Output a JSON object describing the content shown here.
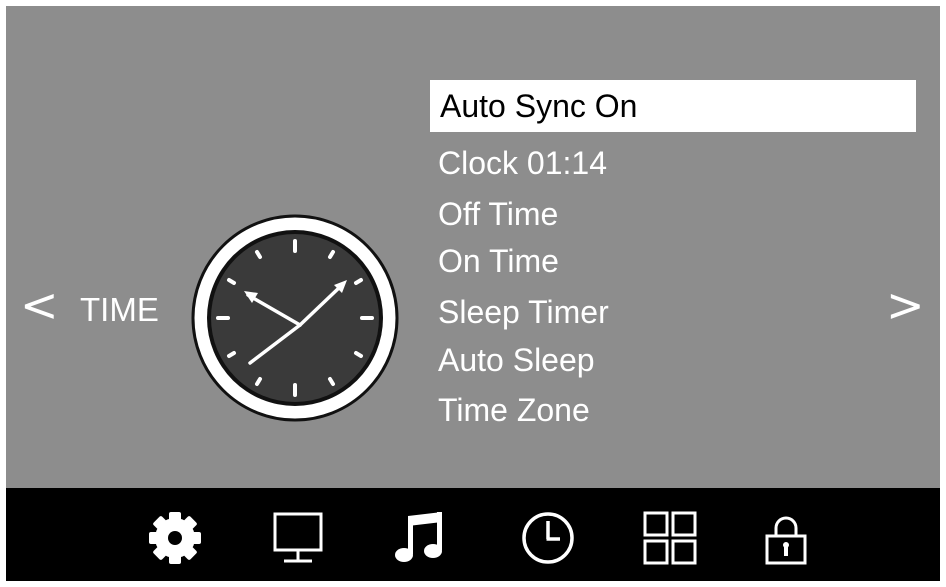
{
  "section": {
    "prev_arrow": "<",
    "label": "TIME",
    "next_arrow": ">"
  },
  "illustration": {
    "icon": "clock-icon",
    "time_shown": "10:10"
  },
  "menu": {
    "selected_index": 0,
    "items": [
      {
        "label": "Auto Sync On"
      },
      {
        "label": "Clock 01:14"
      },
      {
        "label": "Off Time"
      },
      {
        "label": "On Time"
      },
      {
        "label": "Sleep Timer"
      },
      {
        "label": "Auto Sleep"
      },
      {
        "label": "Time Zone"
      }
    ]
  },
  "nav": {
    "active": "clock",
    "icons": [
      "gear-icon",
      "monitor-icon",
      "music-note-icon",
      "clock-icon",
      "grid-icon",
      "lock-icon"
    ]
  },
  "colors": {
    "panel": "#8d8d8d",
    "nav_bar": "#000000",
    "text": "#ffffff",
    "highlight": "#ffffff",
    "highlight_text": "#000000"
  }
}
